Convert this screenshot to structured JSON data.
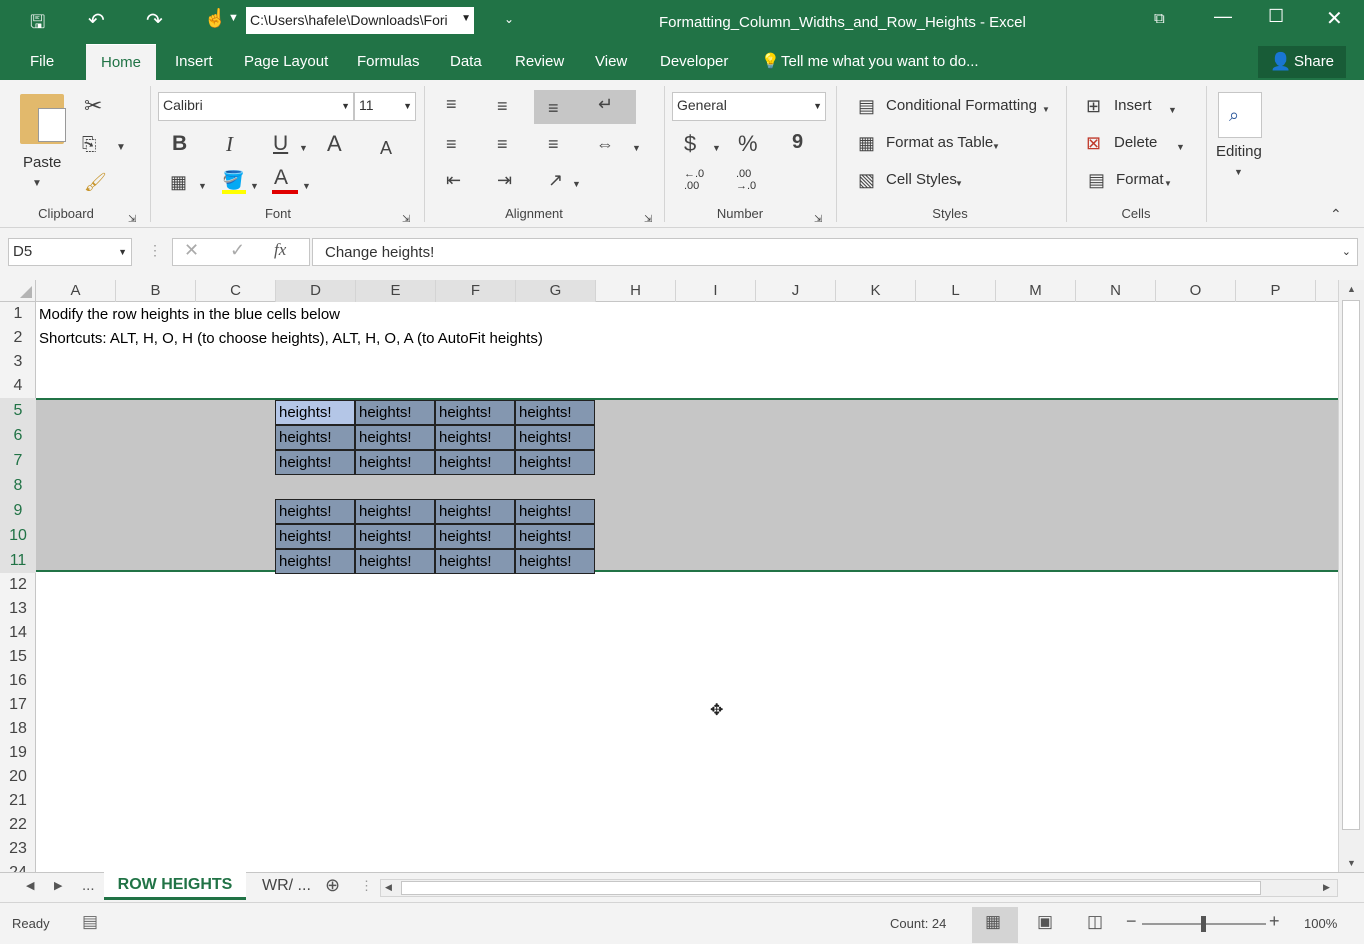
{
  "titlebar": {
    "path": "C:\\Users\\hafele\\Downloads\\Fori",
    "title": "Formatting_Column_Widths_and_Row_Heights - Excel"
  },
  "tabs": {
    "file": "File",
    "home": "Home",
    "insert": "Insert",
    "page_layout": "Page Layout",
    "formulas": "Formulas",
    "data": "Data",
    "review": "Review",
    "view": "View",
    "developer": "Developer",
    "tell_me": "Tell me what you want to do...",
    "share": "Share"
  },
  "ribbon": {
    "paste": "Paste",
    "font_name": "Calibri",
    "font_size": "11",
    "number_format": "General",
    "bold": "B",
    "italic": "I",
    "underline": "U",
    "font_grow": "A",
    "font_shrink": "A",
    "font_color_letter": "A",
    "currency": "$",
    "percent": "%",
    "comma": "9",
    "inc_decimal": "←.0 .00",
    "dec_decimal": ".00 →.0",
    "conditional_formatting": "Conditional Formatting",
    "format_as_table": "Format as Table",
    "cell_styles": "Cell Styles",
    "insert": "Insert",
    "delete": "Delete",
    "format": "Format",
    "editing": "Editing",
    "groups": {
      "clipboard": "Clipboard",
      "font": "Font",
      "alignment": "Alignment",
      "number": "Number",
      "styles": "Styles",
      "cells": "Cells"
    }
  },
  "formula_bar": {
    "name_box": "D5",
    "formula": "Change heights!"
  },
  "columns": [
    "A",
    "B",
    "C",
    "D",
    "E",
    "F",
    "G",
    "H",
    "I",
    "J",
    "K",
    "L",
    "M",
    "N",
    "O",
    "P"
  ],
  "rows": [
    "1",
    "2",
    "3",
    "4",
    "5",
    "6",
    "7",
    "8",
    "9",
    "10",
    "11",
    "12",
    "13",
    "14",
    "15",
    "16",
    "17",
    "18",
    "19",
    "20",
    "21",
    "22",
    "23",
    "24"
  ],
  "cells": {
    "a1": "Modify the row heights in the blue cells below",
    "a2": "Shortcuts: ALT, H, O, H (to choose heights), ALT, H, O, A (to AutoFit heights)",
    "block_value": "heights!"
  },
  "sheet_tabs": {
    "active": "ROW HEIGHTS",
    "other": "WR/ ...",
    "overflow": "..."
  },
  "status": {
    "ready": "Ready",
    "count": "Count: 24",
    "zoom": "100%"
  },
  "colors": {
    "excel_green": "#217346",
    "blue_cell": "#8497b0",
    "selection": "#c6c6c6"
  }
}
